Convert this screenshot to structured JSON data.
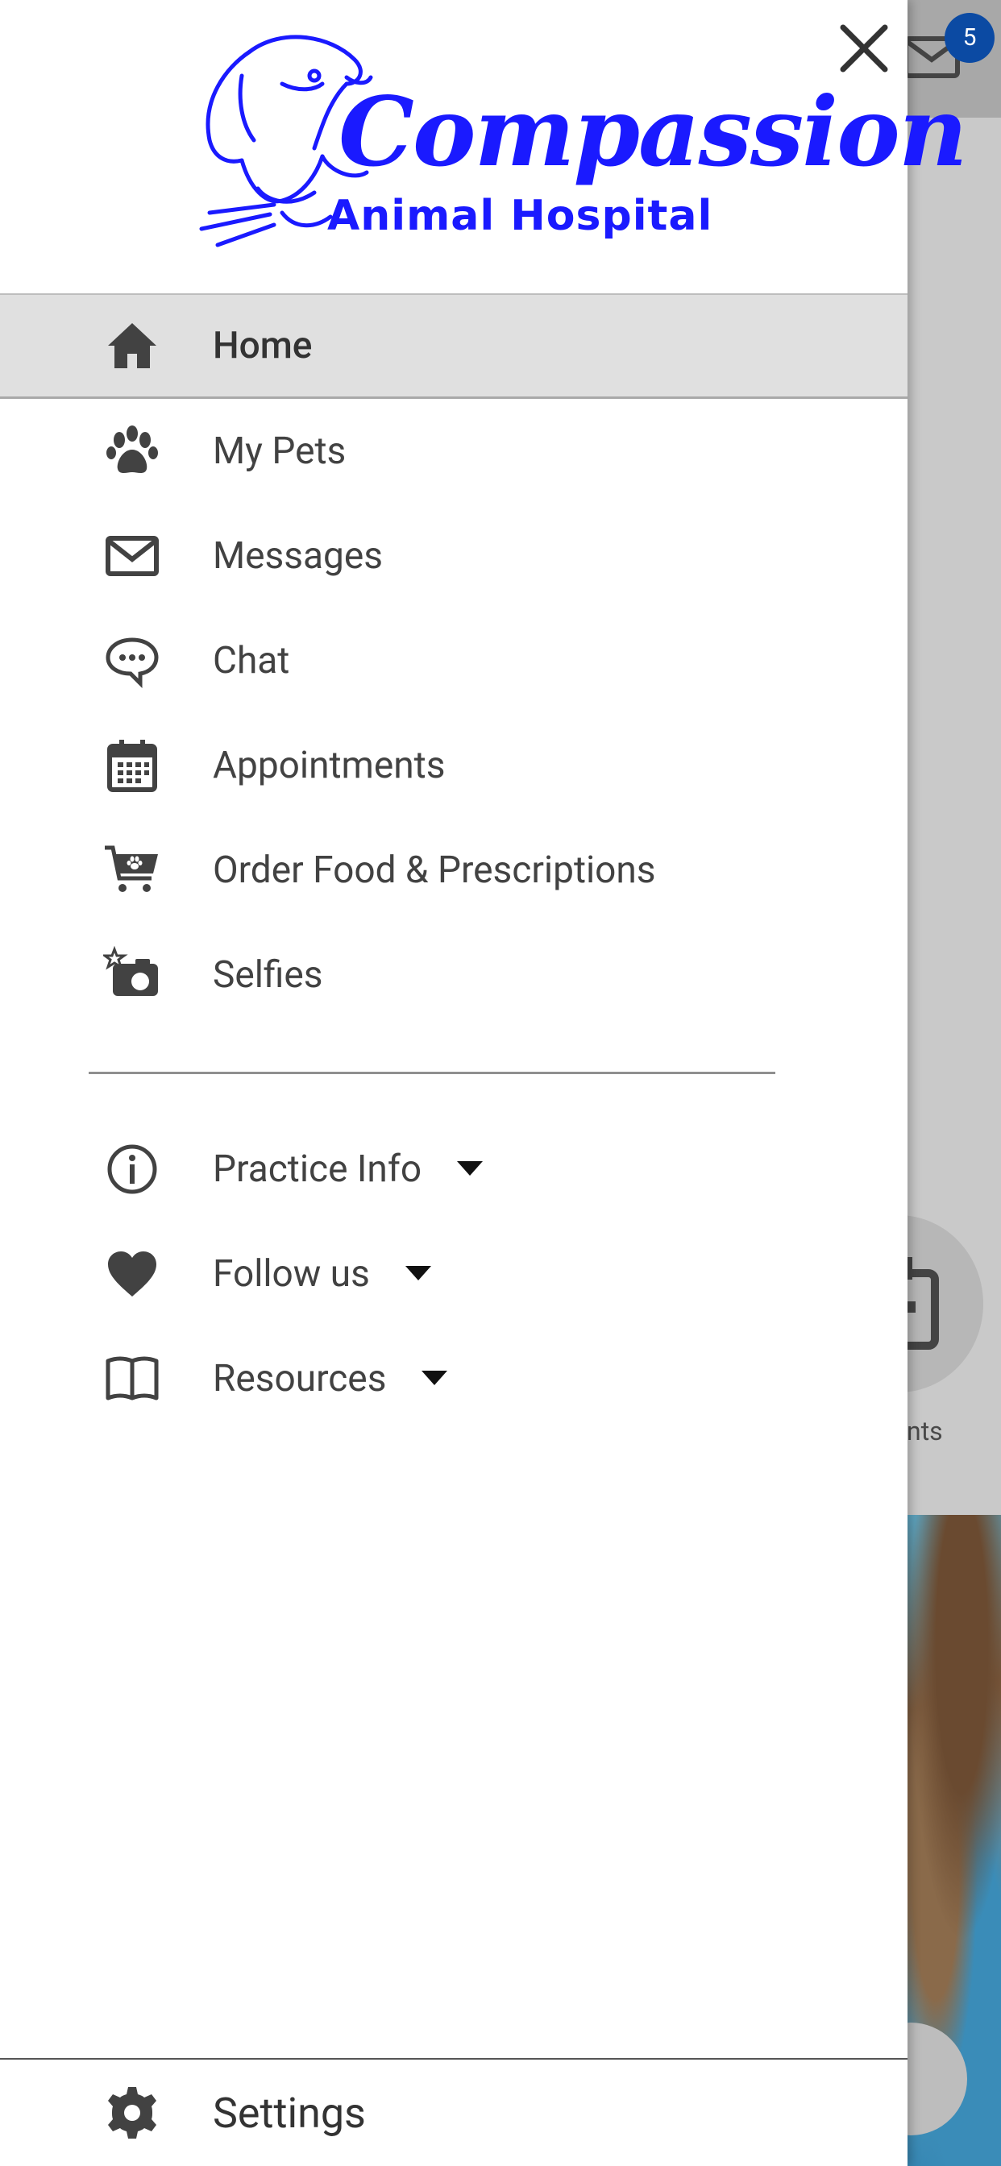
{
  "background": {
    "mail_badge_count": "5",
    "partial_label": "ments"
  },
  "drawer": {
    "logo": {
      "title": "Compassion",
      "subtitle": "Animal Hospital"
    },
    "menu": [
      {
        "label": "Home",
        "icon": "home-icon",
        "active": true
      },
      {
        "label": "My Pets",
        "icon": "paw-icon"
      },
      {
        "label": "Messages",
        "icon": "envelope-icon"
      },
      {
        "label": "Chat",
        "icon": "chat-bubble-icon"
      },
      {
        "label": "Appointments",
        "icon": "calendar-icon"
      },
      {
        "label": "Order Food & Prescriptions",
        "icon": "cart-icon"
      },
      {
        "label": "Selfies",
        "icon": "camera-icon"
      }
    ],
    "submenu": [
      {
        "label": "Practice Info",
        "icon": "info-icon"
      },
      {
        "label": "Follow us",
        "icon": "heart-icon"
      },
      {
        "label": "Resources",
        "icon": "book-icon"
      }
    ],
    "settings_label": "Settings"
  },
  "colors": {
    "logo_blue": "#1a1aff",
    "badge_blue": "#0b4aa3",
    "icon_gray": "#424242"
  }
}
